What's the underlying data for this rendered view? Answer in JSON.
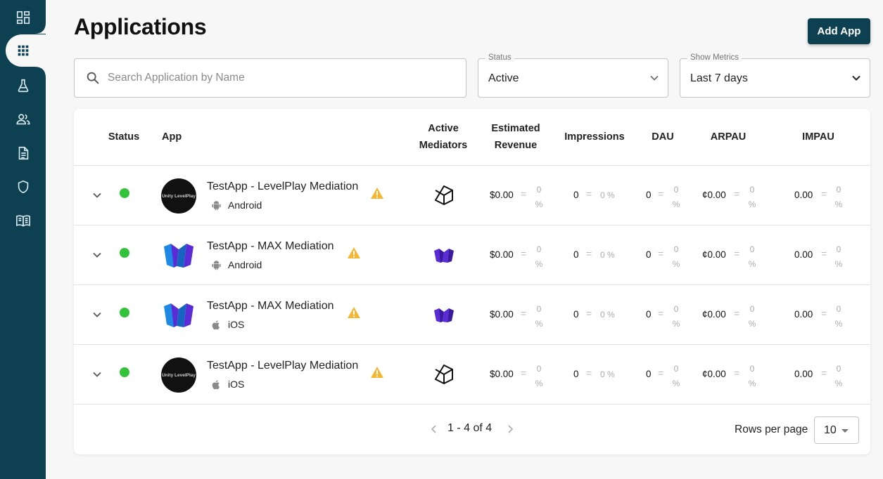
{
  "sidebar": {
    "items": [
      {
        "icon": "dashboard-icon",
        "active": false
      },
      {
        "icon": "apps-grid-icon",
        "active": true
      },
      {
        "icon": "flask-icon",
        "active": false
      },
      {
        "icon": "users-icon",
        "active": false
      },
      {
        "icon": "document-icon",
        "active": false
      },
      {
        "icon": "shield-icon",
        "active": false
      },
      {
        "icon": "book-icon",
        "active": false
      }
    ]
  },
  "header": {
    "title": "Applications",
    "add_button": "Add App"
  },
  "filters": {
    "search_placeholder": "Search Application by Name",
    "search_value": "",
    "status": {
      "label": "Status",
      "value": "Active"
    },
    "metrics": {
      "label": "Show Metrics",
      "value": "Last 7 days"
    }
  },
  "table": {
    "columns": {
      "status": "Status",
      "app": "App",
      "mediators_1": "Active",
      "mediators_2": "Mediators",
      "revenue_1": "Estimated",
      "revenue_2": "Revenue",
      "impressions": "Impressions",
      "dau": "DAU",
      "arpau": "ARPAU",
      "impau": "IMPAU"
    },
    "rows": [
      {
        "name": "TestApp - LevelPlay Mediation",
        "platform": "Android",
        "logo": "levelplay",
        "logo_text": "Unity LevelPlay",
        "mediator": "unity-icon",
        "revenue": "$0.00",
        "impressions": "0",
        "dau": "0",
        "arpau": "¢0.00",
        "impau": "0.00",
        "change": "0",
        "pct": "%",
        "imp_change": "0 %"
      },
      {
        "name": "TestApp - MAX Mediation",
        "platform": "Android",
        "logo": "max",
        "logo_text": "",
        "mediator": "max-icon",
        "revenue": "$0.00",
        "impressions": "0",
        "dau": "0",
        "arpau": "¢0.00",
        "impau": "0.00",
        "change": "0",
        "pct": "%",
        "imp_change": "0 %"
      },
      {
        "name": "TestApp - MAX Mediation",
        "platform": "iOS",
        "logo": "max",
        "logo_text": "",
        "mediator": "max-icon",
        "revenue": "$0.00",
        "impressions": "0",
        "dau": "0",
        "arpau": "¢0.00",
        "impau": "0.00",
        "change": "0",
        "pct": "%",
        "imp_change": "0 %"
      },
      {
        "name": "TestApp - LevelPlay Mediation",
        "platform": "iOS",
        "logo": "levelplay",
        "logo_text": "Unity LevelPlay",
        "mediator": "unity-icon",
        "revenue": "$0.00",
        "impressions": "0",
        "dau": "0",
        "arpau": "¢0.00",
        "impau": "0.00",
        "change": "0",
        "pct": "%",
        "imp_change": "0 %"
      }
    ]
  },
  "pagination": {
    "range": "1 - 4 of 4",
    "rows_per_page_label": "Rows per page",
    "rows_per_page": "10"
  },
  "colors": {
    "sidebar": "#0d4152",
    "status_active": "#32c33a",
    "warning": "#f5b731",
    "max_purple": "#5b2bd6",
    "max_blue": "#1e88e5"
  }
}
